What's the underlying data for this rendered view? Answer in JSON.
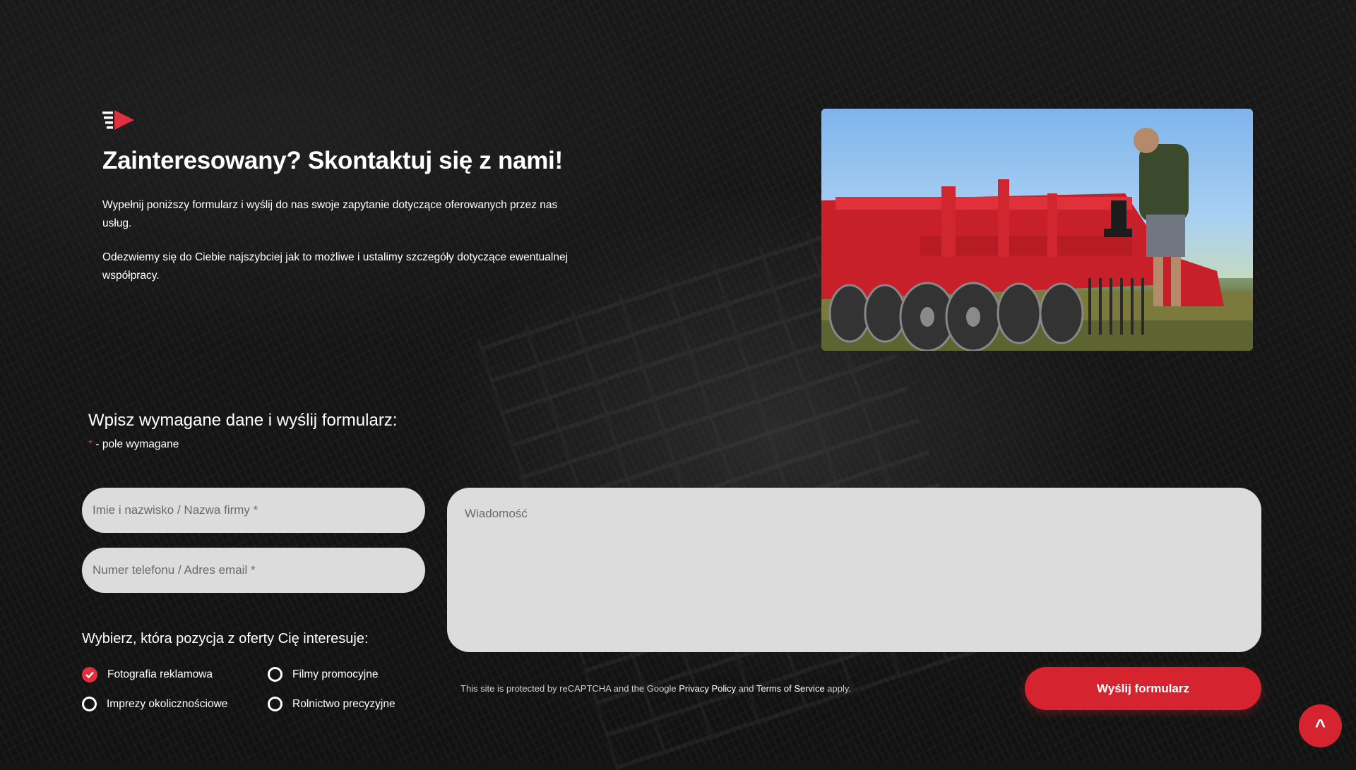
{
  "contact": {
    "title": "Zainteresowany? Skontaktuj się z nami!",
    "intro_1": "Wypełnij poniższy formularz i wyślij do nas swoje zapytanie dotyczące oferowanych przez nas usług.",
    "intro_2": "Odezwiemy się do Ciebie najszybciej jak to możliwe i ustalimy szczegóły dotyczące ewentualnej współpracy."
  },
  "form": {
    "heading": "Wpisz wymagane dane i wyślij formularz:",
    "required_star": "*",
    "required_note": " - pole wymagane",
    "name_placeholder": "Imie i nazwisko / Nazwa firmy *",
    "contact_placeholder": "Numer telefonu / Adres email *",
    "message_placeholder": "Wiadomość",
    "offer_heading": "Wybierz, która pozycja z oferty Cię interesuje:",
    "options": [
      {
        "label": "Fotografia reklamowa",
        "checked": true
      },
      {
        "label": "Filmy promocyjne",
        "checked": false
      },
      {
        "label": "Imprezy okolicznościowe",
        "checked": false
      },
      {
        "label": "Rolnictwo precyzyjne",
        "checked": false
      }
    ],
    "recaptcha": {
      "prefix": "This site is protected by reCAPTCHA and the Google ",
      "privacy": "Privacy Policy",
      "and": " and ",
      "terms": "Terms of Service",
      "suffix": " apply."
    },
    "submit_label": "Wyślij formularz"
  },
  "scroll_top_label": "^",
  "colors": {
    "accent": "#d5232f",
    "background": "#151515",
    "field": "#dcdcdc"
  },
  "icons": {
    "logo": "play-logo-icon",
    "checked": "check-icon",
    "scroll": "chevron-up-icon"
  }
}
